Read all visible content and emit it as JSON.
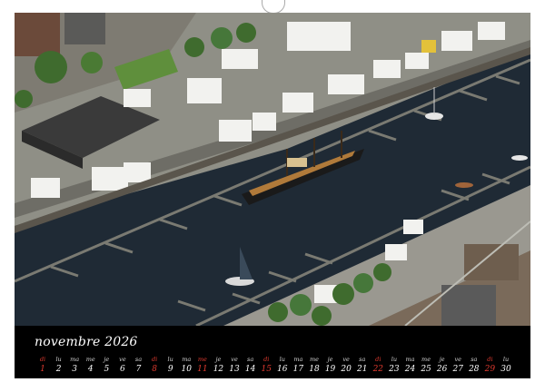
{
  "calendar": {
    "month_label": "novembre 2026",
    "weekdays": [
      "di",
      "lu",
      "ma",
      "me",
      "je",
      "ve",
      "sa",
      "di",
      "lu",
      "ma",
      "me",
      "je",
      "ve",
      "sa",
      "di",
      "lu",
      "ma",
      "me",
      "je",
      "ve",
      "sa",
      "di",
      "lu",
      "ma",
      "me",
      "je",
      "ve",
      "sa",
      "di",
      "lu"
    ],
    "days": [
      "1",
      "2",
      "3",
      "4",
      "5",
      "6",
      "7",
      "8",
      "9",
      "10",
      "11",
      "12",
      "13",
      "14",
      "15",
      "16",
      "17",
      "18",
      "19",
      "20",
      "21",
      "22",
      "23",
      "24",
      "25",
      "26",
      "27",
      "28",
      "29",
      "30"
    ],
    "sundays": [
      1,
      8,
      11,
      15,
      22,
      29
    ],
    "accent_color": "#e03a2f"
  },
  "photo": {
    "subject": "aerial-harbour-scene",
    "icon": "tall-ship-quay-photo"
  }
}
